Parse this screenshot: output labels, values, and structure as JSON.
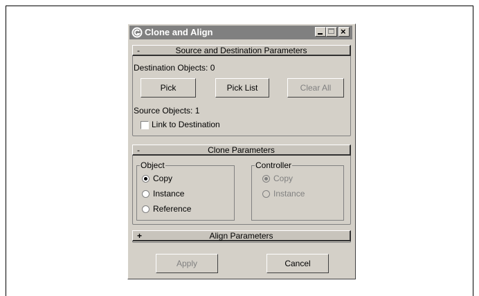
{
  "dialog": {
    "title": "Clone and Align",
    "controls": {
      "minimize": "_",
      "maximize": "□",
      "close": "×"
    }
  },
  "source_rollout": {
    "sign": "-",
    "title": "Source and Destination Parameters",
    "destination_label": "Destination Objects: 0",
    "pick_label": "Pick",
    "pick_list_label": "Pick List",
    "clear_all_label": "Clear All",
    "source_label": "Source Objects: 1",
    "link_label": "Link to Destination"
  },
  "clone_rollout": {
    "sign": "-",
    "title": "Clone Parameters",
    "object_group": {
      "title": "Object",
      "options": [
        "Copy",
        "Instance",
        "Reference"
      ],
      "selected": "Copy"
    },
    "controller_group": {
      "title": "Controller",
      "options": [
        "Copy",
        "Instance"
      ],
      "selected": "Copy"
    }
  },
  "align_rollout": {
    "sign": "+",
    "title": "Align Parameters"
  },
  "footer": {
    "apply_label": "Apply",
    "cancel_label": "Cancel"
  }
}
